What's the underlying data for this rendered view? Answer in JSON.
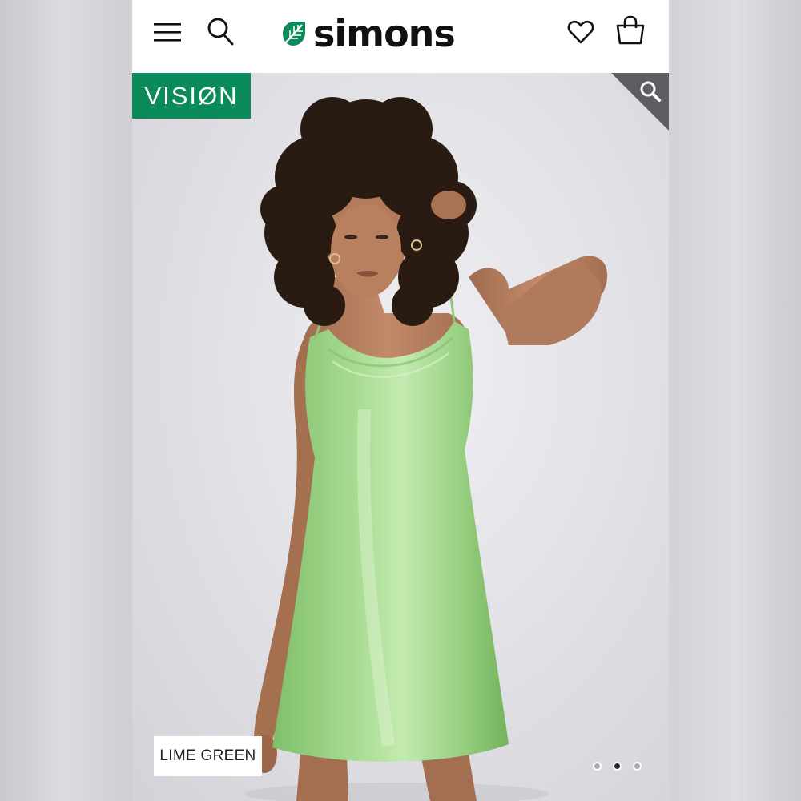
{
  "header": {
    "brand_name": "simons",
    "icons": {
      "menu": "hamburger-menu-icon",
      "search": "search-icon",
      "wishlist": "heart-icon",
      "bag": "shopping-bag-icon"
    }
  },
  "hero": {
    "badge_label": "VISIØN",
    "zoom_icon": "magnifier-icon",
    "color_label": "LIME GREEN",
    "carousel": {
      "total": 3,
      "active": 2
    }
  },
  "colors": {
    "brand_green": "#0b8a5a",
    "dress_green": "#9ed28a",
    "text_dark": "#111111"
  }
}
